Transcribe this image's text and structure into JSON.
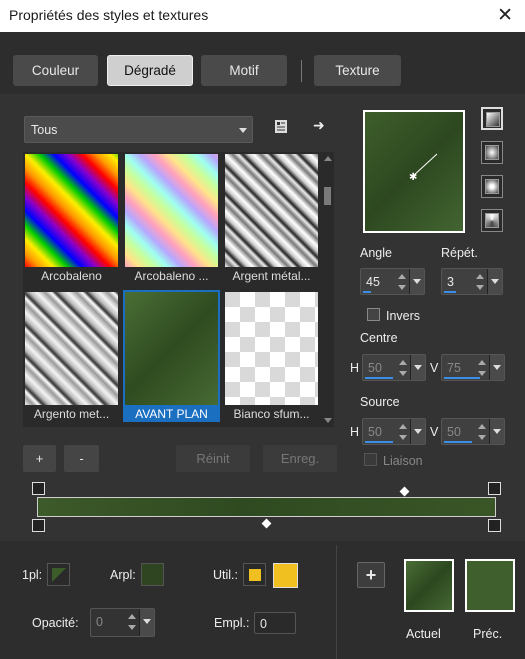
{
  "title": "Propriétés des styles et textures",
  "tabs": [
    {
      "label": "Couleur"
    },
    {
      "label": "Dégradé"
    },
    {
      "label": "Motif"
    },
    {
      "label": "Texture"
    }
  ],
  "filter": {
    "value": "Tous"
  },
  "gallery": [
    {
      "label": "Arcobaleno"
    },
    {
      "label": "Arcobaleno ..."
    },
    {
      "label": "Argent métal..."
    },
    {
      "label": "Argento met..."
    },
    {
      "label": "AVANT PLAN",
      "selected": true
    },
    {
      "label": "Bianco sfum..."
    }
  ],
  "buttons": {
    "add": "+",
    "remove": "-",
    "reset": "Réinit",
    "save": "Enreg."
  },
  "controls": {
    "angle_label": "Angle",
    "angle_value": "45",
    "repeat_label": "Répét.",
    "repeat_value": "3",
    "invert_label": "Invers",
    "centre_label": "Centre",
    "centre_h": "50",
    "centre_v": "75",
    "source_label": "Source",
    "source_h": "50",
    "source_v": "50",
    "link_label": "Liaison",
    "h_letter": "H",
    "v_letter": "V"
  },
  "bottom": {
    "fg_label": "1pl:",
    "bg_label": "Arpl:",
    "use_label": "Util.:",
    "opacity_label": "Opacité:",
    "opacity_value": "0",
    "location_label": "Empl.:",
    "location_value": "0",
    "current_label": "Actuel",
    "previous_label": "Préc.",
    "plus": "+"
  },
  "colors": {
    "gradient_green": "#3f5f2c",
    "selection": "#1a6fc1",
    "use_color": "#f0c020"
  }
}
